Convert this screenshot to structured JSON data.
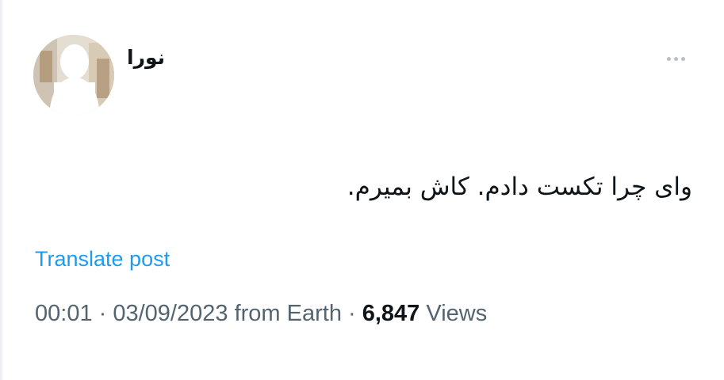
{
  "author": {
    "name": "نورا"
  },
  "post": {
    "text": "وای چرا تکست دادم. کاش بمیرم.",
    "translate_label": "Translate post"
  },
  "meta": {
    "time": "00:01",
    "separator": " · ",
    "date": "03/09/2023",
    "source": " from Earth",
    "views_count": "6,847",
    "views_label": " Views"
  },
  "icons": {
    "more": "more-horizontal-icon"
  },
  "colors": {
    "link": "#1d9bf0",
    "secondary_text": "#536471",
    "primary_text": "#0f1419"
  }
}
